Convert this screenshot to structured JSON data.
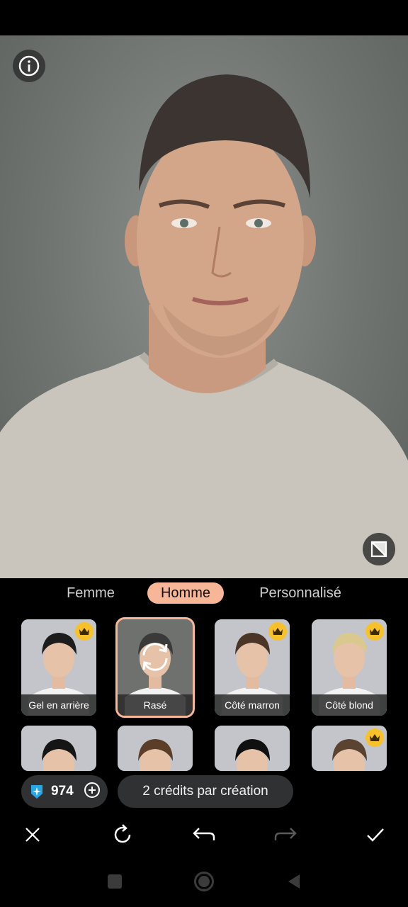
{
  "photo": {
    "info_icon": "info-icon",
    "compare_icon": "compare-icon"
  },
  "tabs": [
    {
      "label": "Femme",
      "active": false
    },
    {
      "label": "Homme",
      "active": true
    },
    {
      "label": "Personnalisé",
      "active": false
    }
  ],
  "styles": [
    {
      "label": "Gel en arrière",
      "premium": true,
      "selected": false,
      "hair": "#1c1c1c"
    },
    {
      "label": "Rasé",
      "premium": false,
      "selected": true,
      "hair": "#3a3a3a"
    },
    {
      "label": "Côté marron",
      "premium": true,
      "selected": false,
      "hair": "#4a3526"
    },
    {
      "label": "Côté blond",
      "premium": true,
      "selected": false,
      "hair": "#d9c98e"
    },
    {
      "label": "",
      "premium": false,
      "selected": false,
      "hair": "#151515"
    },
    {
      "label": "",
      "premium": false,
      "selected": false,
      "hair": "#5a3e28"
    },
    {
      "label": "",
      "premium": false,
      "selected": false,
      "hair": "#101010"
    },
    {
      "label": "",
      "premium": true,
      "selected": false,
      "hair": "#5a4330"
    }
  ],
  "credits": {
    "count": "974",
    "icon": "gem-icon",
    "add_icon": "plus-circle-icon"
  },
  "tooltip": "2 crédits par création",
  "toolbar": {
    "close_icon": "close-icon",
    "refresh_icon": "refresh-icon",
    "undo_icon": "undo-icon",
    "redo_icon": "redo-icon",
    "confirm_icon": "check-icon"
  },
  "colors": {
    "accent": "#f7b697",
    "crown": "#f6c12a",
    "gem": "#27a7e6"
  }
}
